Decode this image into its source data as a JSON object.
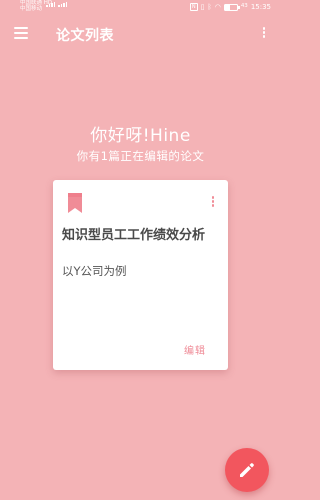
{
  "status_bar": {
    "carrier_1": "中国联通 HD",
    "carrier_2": "中国移动",
    "battery": "43",
    "time": "15:35"
  },
  "header": {
    "title": "论文列表"
  },
  "greeting": {
    "title": "你好呀!Hine",
    "subtitle": "你有1篇正在编辑的论文"
  },
  "paper_card": {
    "title": "知识型员工工作绩效分析",
    "subtitle": "以Y公司为例",
    "edit_label": "编辑"
  },
  "colors": {
    "background": "#F4B3B6",
    "accent": "#EF8A96",
    "fab": "#F2565E"
  },
  "icons": {
    "menu": "menu-icon",
    "more": "more-vert-icon",
    "bookmark": "bookmark-icon",
    "edit": "pencil-icon"
  }
}
